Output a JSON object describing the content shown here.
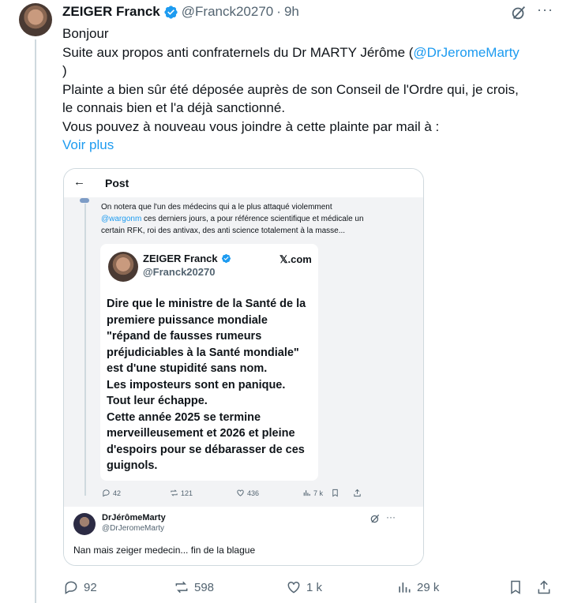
{
  "author": {
    "name": "ZEIGER Franck",
    "handle": "@Franck20270",
    "separator": "·",
    "time": "9h"
  },
  "tweet": {
    "line1": "Bonjour",
    "line2_before": "Suite aux propos anti confraternels du Dr MARTY Jérôme (",
    "line2_mention": "@DrJeromeMarty",
    "line3": ")",
    "line4": "Plainte a bien sûr été déposée auprès de son Conseil de l'Ordre qui, je crois,",
    "line5": "le connais bien et l'a déjà sanctionné.",
    "line6": "Vous pouvez à nouveau vous joindre à cette plainte par mail à :",
    "show_more": "Voir plus"
  },
  "card": {
    "header_title": "Post",
    "back_icon": "←",
    "text_line1": "On notera que l'un des médecins qui a le plus attaqué violemment",
    "text_line2_mention": "@wargonm",
    "text_line2_rest": " ces derniers jours, a pour référence scientifique et médicale un",
    "text_line3": "certain RFK, roi des antivax, des anti science totalement à la masse...",
    "quote": {
      "name": "ZEIGER Franck",
      "handle": "@Franck20270",
      "source": "𝕏.com",
      "lines": [
        "Dire que le ministre de la Santé de la",
        "premiere puissance mondiale",
        "\"répand de fausses rumeurs",
        "préjudiciables à la Santé mondiale\"",
        "est d'une stupidité sans nom.",
        "Les imposteurs sont en panique.",
        "Tout leur échappe.",
        "Cette année 2025 se termine",
        "merveilleusement et 2026 et pleine",
        "d'espoirs pour se débarasser de ces",
        "guignols."
      ]
    },
    "stats": {
      "replies": "42",
      "reposts": "121",
      "likes": "436",
      "views": "7 k"
    },
    "reply": {
      "name": "DrJérômeMarty",
      "handle": "@DrJeromeMarty",
      "text": "Nan mais zeiger medecin... fin de la blague"
    }
  },
  "actions": {
    "replies": "92",
    "reposts": "598",
    "likes": "1 k",
    "views": "29 k"
  },
  "colors": {
    "accent": "#1d9bf0",
    "text": "#0f1419",
    "secondary": "#536471",
    "border": "#cfd9de"
  }
}
